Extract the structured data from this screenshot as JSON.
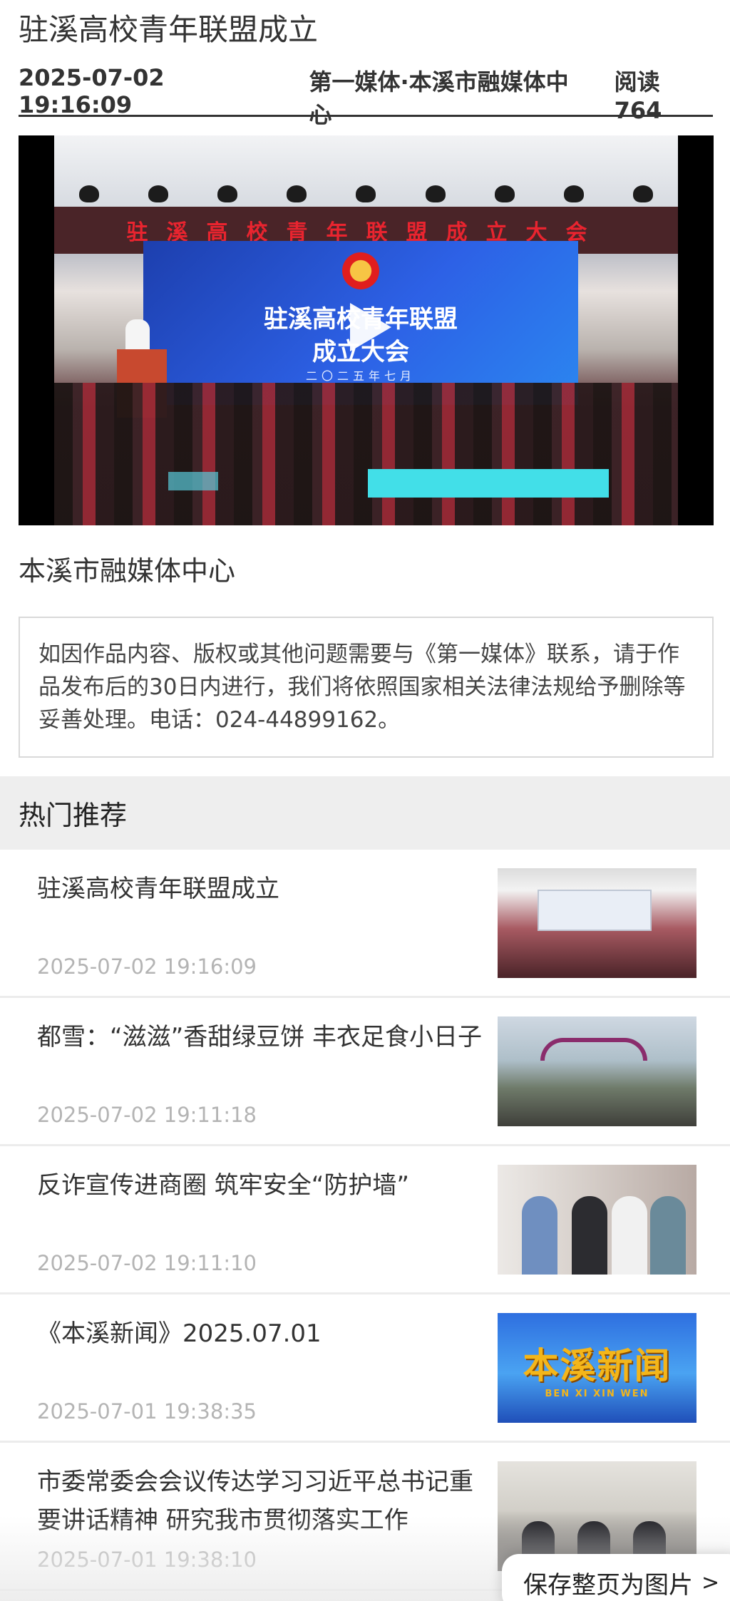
{
  "article": {
    "title": "驻溪高校青年联盟成立",
    "datetime": "2025-07-02 19:16:09",
    "publisher": "第一媒体·本溪市融媒体中心",
    "read_count": "阅读 764"
  },
  "video": {
    "banner_text": "驻溪高校青年联盟成立大会",
    "screen_line1": "驻溪高校青年联盟",
    "screen_line2": "成立大会",
    "screen_date": "二〇二五年七月"
  },
  "source": "本溪市融媒体中心",
  "notice": "如因作品内容、版权或其他问题需要与《第一媒体》联系，请于作品发布后的30日内进行，我们将依照国家相关法律法规给予删除等妥善处理。电话：024-44899162。",
  "hot": {
    "heading": "热门推荐",
    "items": [
      {
        "title": "驻溪高校青年联盟成立",
        "time": "2025-07-02 19:16:09"
      },
      {
        "title": "都雪：“滋滋”香甜绿豆饼 丰衣足食小日子",
        "time": "2025-07-02 19:11:18"
      },
      {
        "title": "反诈宣传进商圈 筑牢安全“防护墙”",
        "time": "2025-07-02 19:11:10"
      },
      {
        "title": "《本溪新闻》2025.07.01",
        "time": "2025-07-01 19:38:35",
        "thumb_text": "本溪新闻",
        "thumb_sub": "BEN XI XIN WEN"
      },
      {
        "title": "市委常委会会议传达学习习近平总书记重要讲话精神 研究我市贯彻落实工作",
        "time": "2025-07-01 19:38:10"
      }
    ]
  },
  "save_button": {
    "label": "保存整页为图片",
    "icon": "chevron-right-icon"
  },
  "colors": {
    "overlay_cyan": "#42dfe8",
    "banner_red": "#e9242f",
    "time_gray": "#b4b4b4"
  }
}
